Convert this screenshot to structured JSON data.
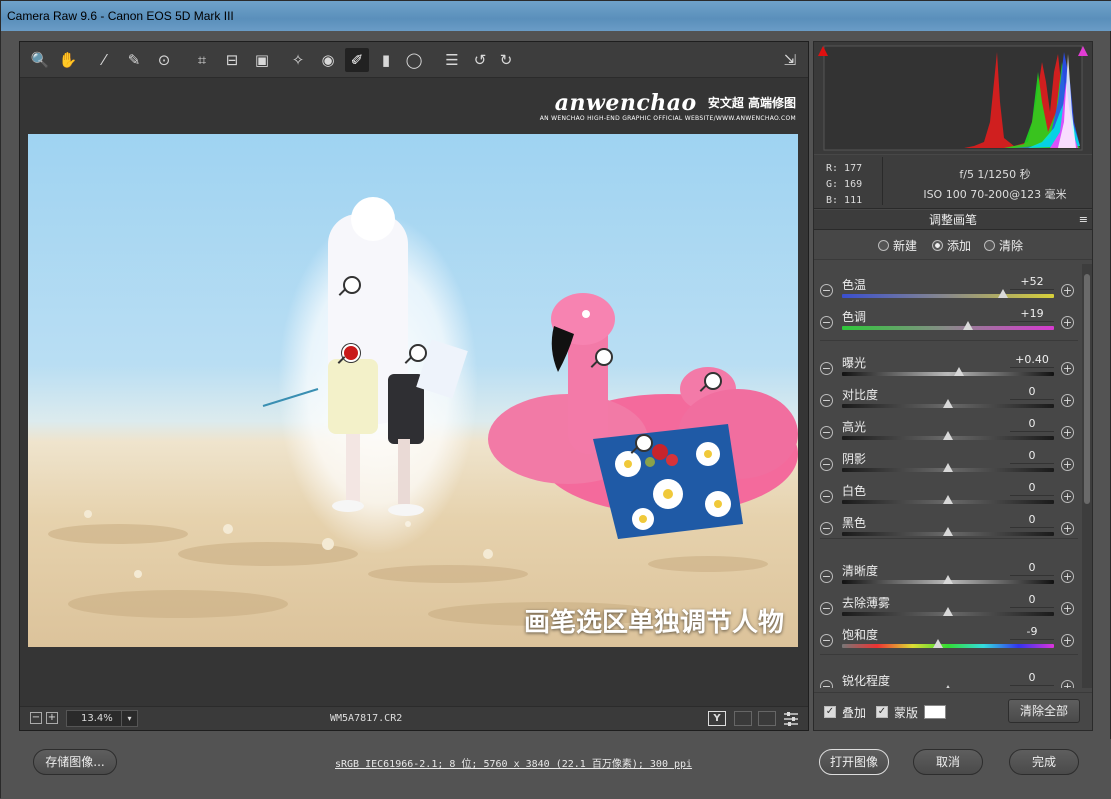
{
  "window": {
    "title": "Camera Raw 9.6 -  Canon EOS 5D Mark III"
  },
  "toolbar": {
    "tools": [
      {
        "name": "zoom-tool",
        "glyph": "🔍"
      },
      {
        "name": "hand-tool",
        "glyph": "✋"
      },
      {
        "name": "white-balance-tool",
        "glyph": "⁄"
      },
      {
        "name": "color-sampler-tool",
        "glyph": "✎"
      },
      {
        "name": "targeted-adjustment-tool",
        "glyph": "⊙"
      },
      {
        "name": "crop-tool",
        "glyph": "⌗"
      },
      {
        "name": "straighten-tool",
        "glyph": "⊟"
      },
      {
        "name": "transform-tool",
        "glyph": "▣"
      },
      {
        "name": "spot-removal-tool",
        "glyph": "✧"
      },
      {
        "name": "red-eye-tool",
        "glyph": "◉"
      },
      {
        "name": "adjustment-brush-tool",
        "glyph": "✐"
      },
      {
        "name": "graduated-filter-tool",
        "glyph": "▮"
      },
      {
        "name": "radial-filter-tool",
        "glyph": "◯"
      },
      {
        "name": "preferences-tool",
        "glyph": "☰"
      },
      {
        "name": "rotate-left-tool",
        "glyph": "↺"
      },
      {
        "name": "rotate-right-tool",
        "glyph": "↻"
      }
    ],
    "export_glyph": "⇲"
  },
  "watermark": {
    "brand": "anwenchao",
    "cn": "安文超 高端修图",
    "sub": "AN WENCHAO HIGH-END GRAPHIC OFFICIAL WEBSITE/WWW.ANWENCHAO.COM"
  },
  "photo": {
    "overlay_text": "画笔选区单独调节人物"
  },
  "statusbar": {
    "zoom": "13.4%",
    "filename": "WM5A7817.CR2",
    "minus": "−",
    "plus": "+",
    "arrow": "▾",
    "y_button": "Y"
  },
  "bottom": {
    "save_label": "存储图像...",
    "info": "sRGB IEC61966-2.1; 8 位; 5760 x 3840 (22.1 百万像素); 300 ppi",
    "open_label": "打开图像",
    "cancel_label": "取消",
    "done_label": "完成"
  },
  "readout": {
    "r": "R:  177",
    "g": "G:  169",
    "b": "B:  111",
    "line1": "f/5   1/1250 秒",
    "line2": "ISO 100   70-200@123 毫米"
  },
  "panel": {
    "title": "调整画笔",
    "menu_glyph": "≡",
    "modes": {
      "new": "新建",
      "add": "添加",
      "clear": "清除",
      "selected": "add"
    }
  },
  "sliders": [
    {
      "id": "temperature",
      "label": "色温",
      "value": "+52",
      "pos": 0.76,
      "track": "temp"
    },
    {
      "id": "tint",
      "label": "色调",
      "value": "+19",
      "pos": 0.595,
      "track": "tint"
    },
    {
      "id": "exposure",
      "label": "曝光",
      "value": "+0.40",
      "pos": 0.55,
      "track": "gray"
    },
    {
      "id": "contrast",
      "label": "对比度",
      "value": "0",
      "pos": 0.5,
      "track": "gray"
    },
    {
      "id": "highlights",
      "label": "高光",
      "value": "0",
      "pos": 0.5,
      "track": "gray"
    },
    {
      "id": "shadows",
      "label": "阴影",
      "value": "0",
      "pos": 0.5,
      "track": "gray"
    },
    {
      "id": "whites",
      "label": "白色",
      "value": "0",
      "pos": 0.5,
      "track": "gray"
    },
    {
      "id": "blacks",
      "label": "黑色",
      "value": "0",
      "pos": 0.5,
      "track": "gray"
    },
    {
      "id": "clarity",
      "label": "清晰度",
      "value": "0",
      "pos": 0.5,
      "track": "gray"
    },
    {
      "id": "dehaze",
      "label": "去除薄雾",
      "value": "0",
      "pos": 0.5,
      "track": "gray"
    },
    {
      "id": "saturation",
      "label": "饱和度",
      "value": "-9",
      "pos": 0.455,
      "track": "sat"
    },
    {
      "id": "sharpness",
      "label": "锐化程度",
      "value": "0",
      "pos": 0.5,
      "track": "gray"
    }
  ],
  "footer": {
    "overlay_label": "叠加",
    "mask_label": "蒙版",
    "clear_all_label": "清除全部",
    "check_glyph": "✓"
  },
  "colors": {
    "accent_red": "#c91a1a",
    "flamingo": "#f46a9c",
    "sky": "#a8d8f2"
  }
}
